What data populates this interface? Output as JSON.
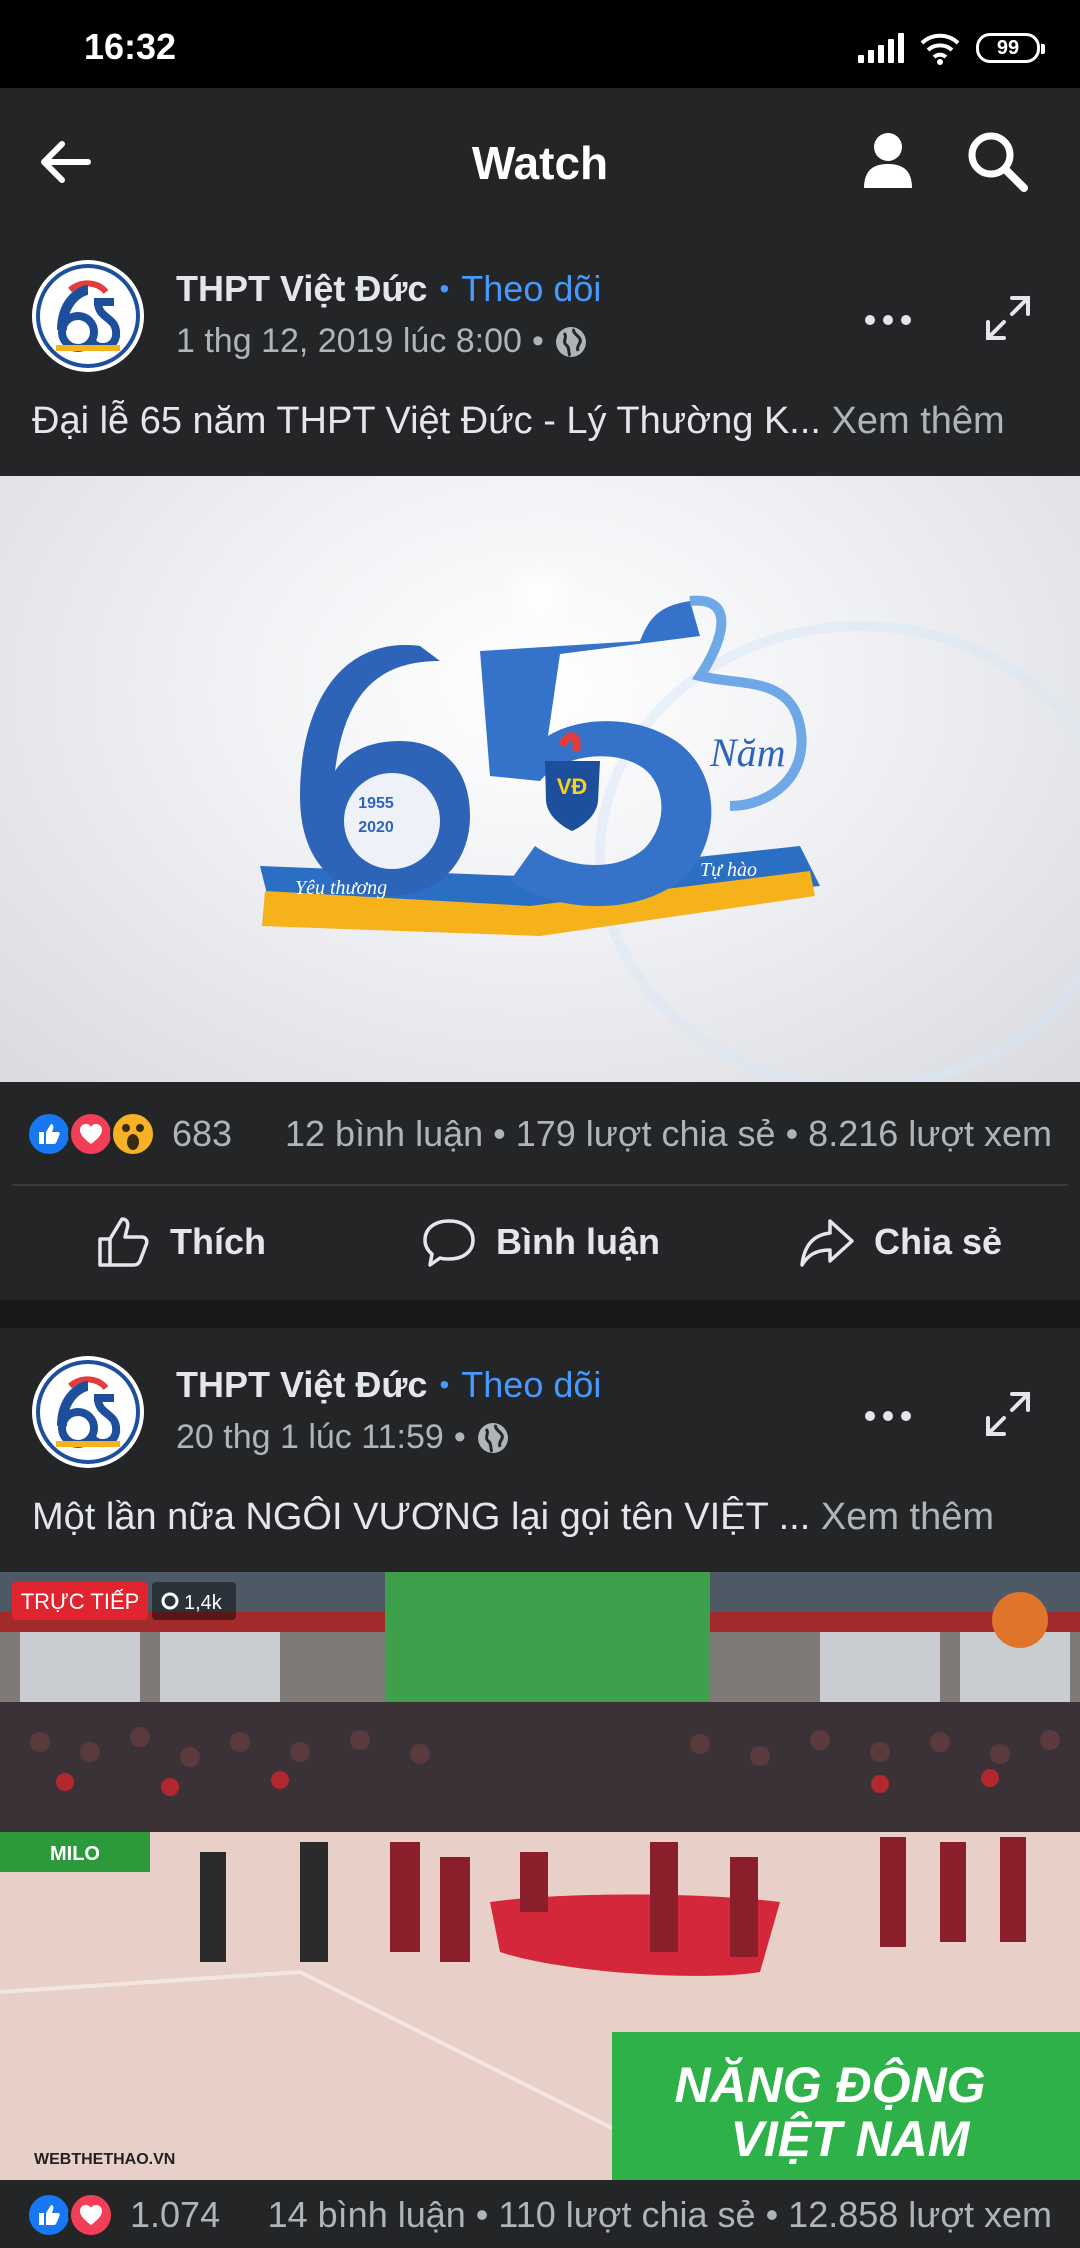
{
  "status_bar": {
    "time": "16:32",
    "battery": "99"
  },
  "header": {
    "title": "Watch"
  },
  "posts": [
    {
      "author": "THPT Việt Đức",
      "follow": "Theo dõi",
      "timestamp": "1 thg 12, 2019 lúc 8:00",
      "caption": "Đại lễ 65 năm THPT Việt Đức - Lý Thường K...",
      "see_more": "Xem thêm",
      "video_labels": {
        "years_top": "1955",
        "years_bottom": "2020",
        "nam": "Năm",
        "logo": "VĐ",
        "left_ribbon": "Yêu thương",
        "right_ribbon": "Tự hào"
      },
      "reaction_count": "683",
      "stats": "12 bình luận • 179 lượt chia sẻ • 8.216 lượt xem",
      "actions": {
        "like": "Thích",
        "comment": "Bình luận",
        "share": "Chia sẻ"
      }
    },
    {
      "author": "THPT Việt Đức",
      "follow": "Theo dõi",
      "timestamp": "20 thg 1 lúc 11:59",
      "caption": "Một lần nữa NGÔI VƯƠNG lại gọi tên VIỆT ...",
      "see_more": "Xem thêm",
      "live_badge": "TRỰC TIẾP",
      "viewer_count": "1,4k",
      "watermark": "WEBTHETHAO.VN",
      "banner_line1": "NĂNG ĐỘNG",
      "banner_line2": "VIỆT NAM",
      "milo": "MILO",
      "reaction_count": "1.074",
      "stats": "14 bình luận • 110 lượt chia sẻ • 12.858 lượt xem"
    }
  ],
  "colors": {
    "background": "#18191a",
    "card": "#242526",
    "accent": "#4599ff",
    "muted": "#b0b3b8",
    "text": "#e4e6eb"
  }
}
